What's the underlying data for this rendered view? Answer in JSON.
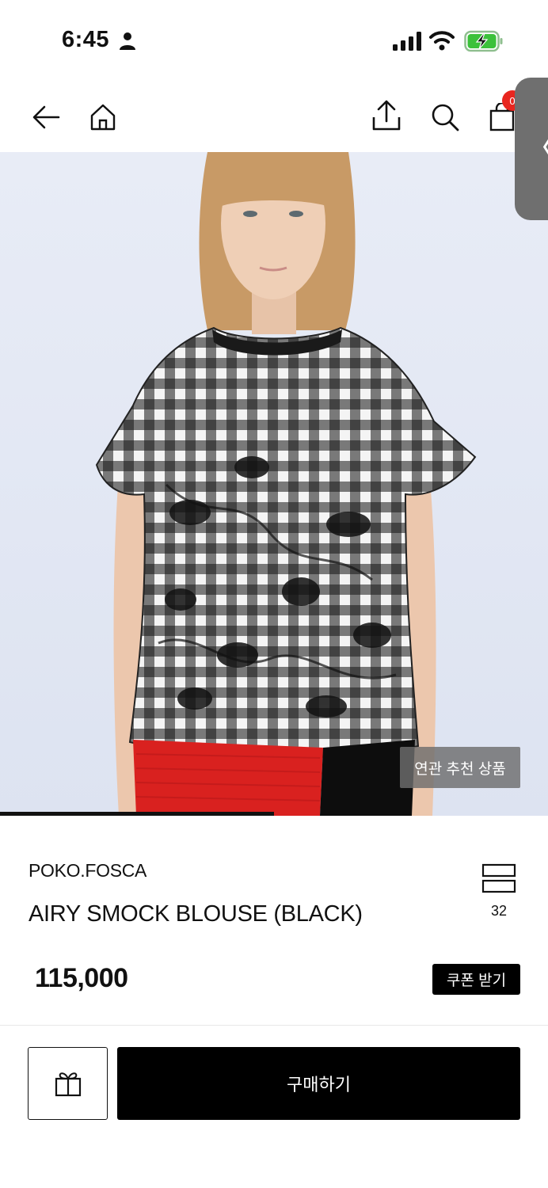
{
  "status_bar": {
    "time": "6:45",
    "icons": [
      "person-icon",
      "signal-icon",
      "wifi-icon",
      "battery-charging-icon"
    ]
  },
  "nav": {
    "icons": [
      "back-arrow-icon",
      "home-icon",
      "share-icon",
      "search-icon",
      "shopping-bag-icon"
    ],
    "cart_badge": "0"
  },
  "side_handle": {
    "label": "〈"
  },
  "hero": {
    "related_products_label": "연관 추천 상품",
    "image_progress": 0.5
  },
  "product": {
    "brand": "POKO.FOSCA",
    "name": "AIRY SMOCK BLOUSE (BLACK)",
    "wish_count": "32",
    "price": "115,000",
    "coupon_label": "쿠폰 받기"
  },
  "actions": {
    "gift_icon": "gift-icon",
    "buy_label": "구매하기"
  },
  "colors": {
    "accent_badge": "#e8261f",
    "primary_button": "#000000",
    "hero_bg": "#e6eaf5"
  }
}
